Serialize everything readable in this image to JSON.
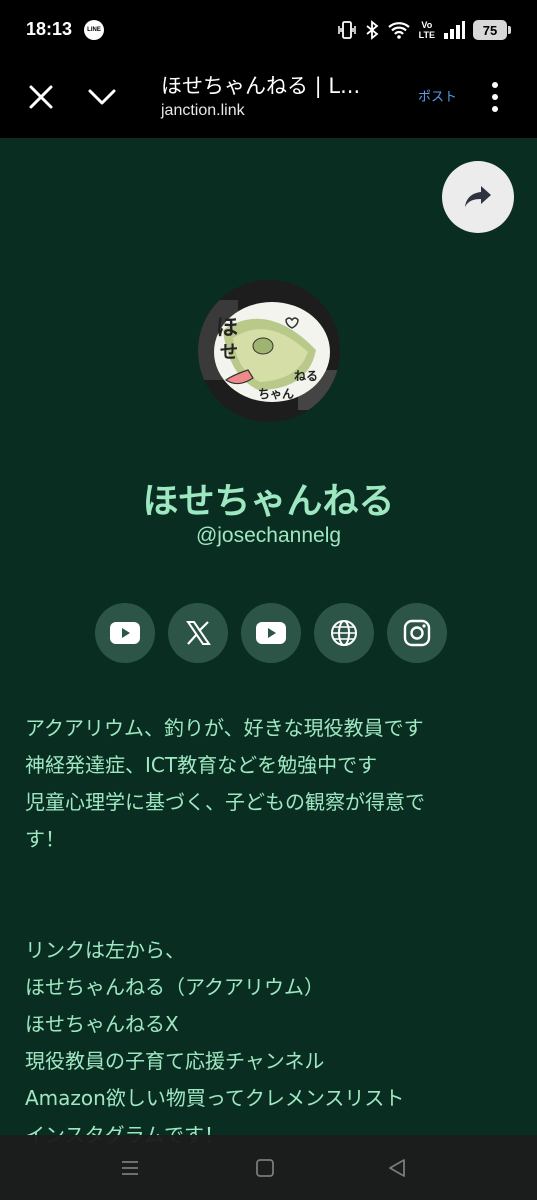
{
  "status": {
    "time": "18:13",
    "line_badge": "LINE",
    "volte_top": "Vo",
    "volte_bottom": "LTE",
    "battery": "75"
  },
  "browser": {
    "title": "ほせちゃんねる | L...",
    "url": "janction.link",
    "post_label": "ポスト"
  },
  "profile": {
    "name": "ほせちゃんねる",
    "handle": "@josechannelg"
  },
  "socials": [
    {
      "icon": "youtube-icon"
    },
    {
      "icon": "x-icon"
    },
    {
      "icon": "youtube-icon"
    },
    {
      "icon": "globe-icon"
    },
    {
      "icon": "instagram-icon"
    }
  ],
  "bio": {
    "para1": [
      "アクアリウム、釣りが、好きな現役教員です",
      "神経発達症、ICT教育などを勉強中です",
      "児童心理学に基づく、子どもの観察が得意で",
      "す！"
    ],
    "para2": [
      "リンクは左から、",
      "ほせちゃんねる（アクアリウム）",
      "ほせちゃんねるX",
      "現役教員の子育て応援チャンネル",
      "Amazon欲しい物買ってクレメンスリスト",
      "インスタグラムです！"
    ]
  },
  "colors": {
    "background": "#0a2d22",
    "accent": "#9ee8c1",
    "social_bg": "#2d5547",
    "link_blue": "#5b9cf0"
  }
}
